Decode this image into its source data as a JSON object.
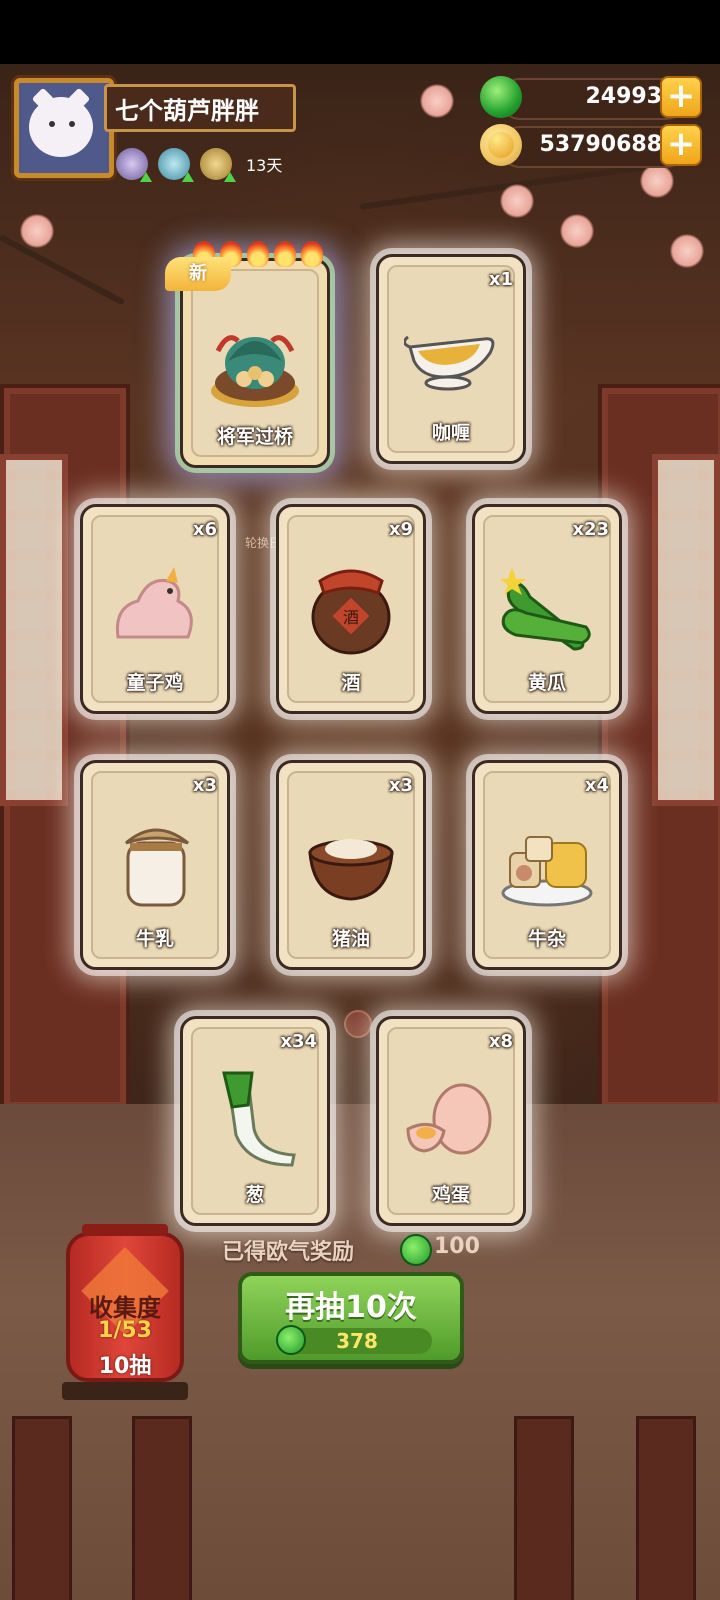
{
  "player": {
    "name": "七个葫芦胖胖",
    "days": "13天"
  },
  "currency": {
    "gems": "24993",
    "coins": "53790688",
    "plus": "+"
  },
  "special_card": {
    "label": "将军过桥",
    "badge": "新",
    "caption": "轮换日历"
  },
  "cards": [
    {
      "label": "咖喱",
      "qty": "x1"
    },
    {
      "label": "童子鸡",
      "qty": "x6"
    },
    {
      "label": "酒",
      "qty": "x9"
    },
    {
      "label": "黄瓜",
      "qty": "x23"
    },
    {
      "label": "牛乳",
      "qty": "x3"
    },
    {
      "label": "猪油",
      "qty": "x3"
    },
    {
      "label": "牛杂",
      "qty": "x4"
    },
    {
      "label": "葱",
      "qty": "x34"
    },
    {
      "label": "鸡蛋",
      "qty": "x8"
    }
  ],
  "reward": {
    "text": "已得欧气奖励",
    "amount": "100"
  },
  "draw_button": {
    "label": "再抽10次",
    "cost": "378"
  },
  "collection": {
    "title": "收集度",
    "progress": "1/53",
    "draws": "10抽"
  },
  "colors": {
    "card_bg": "#f1e2c3",
    "button_green": "#6fb840",
    "lantern_red": "#d23a2e",
    "gold": "#f0a51a"
  }
}
